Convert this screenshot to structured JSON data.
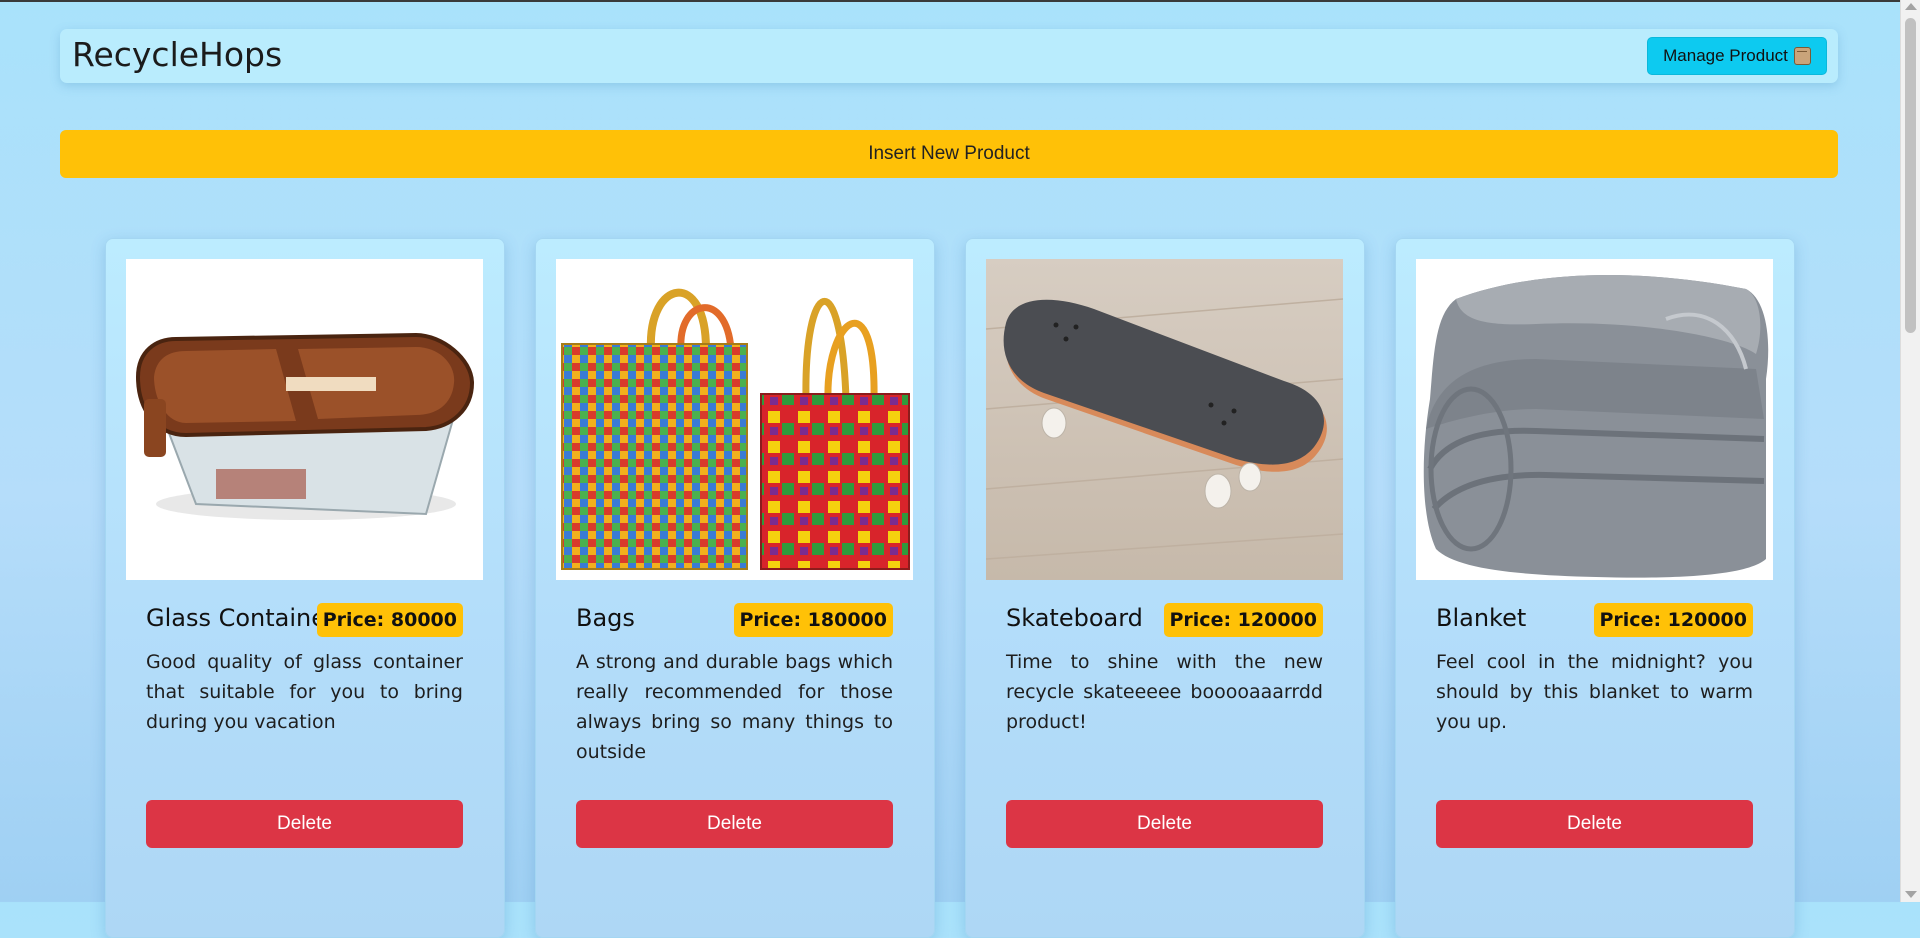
{
  "navbar": {
    "brand": "RecycleHops",
    "manage_label": "Manage Product"
  },
  "actions": {
    "insert_label": "Insert New Product"
  },
  "products": [
    {
      "name": "Glass Container",
      "price": "Price: 80000",
      "description": "Good quality of glass container that suitable for you to bring during you vacation",
      "delete_label": "Delete",
      "image": "glass-container-image"
    },
    {
      "name": "Bags",
      "price": "Price: 180000",
      "description": "A strong and durable bags which really recommended for those always bring so many things to outside",
      "delete_label": "Delete",
      "image": "bags-image"
    },
    {
      "name": "Skateboard",
      "price": "Price: 120000",
      "description": "Time to shine with the new recycle skateeeee booooaaarrdd product!",
      "delete_label": "Delete",
      "image": "skateboard-image"
    },
    {
      "name": "Blanket",
      "price": "Price: 120000",
      "description": "Feel cool in the midnight? you should by this blanket to warm you up.",
      "delete_label": "Delete",
      "image": "blanket-image"
    }
  ],
  "colors": {
    "accent_info": "#0dcaf0",
    "accent_warning": "#ffc107",
    "danger": "#dc3545"
  },
  "icons": {
    "manage": "box-icon"
  }
}
